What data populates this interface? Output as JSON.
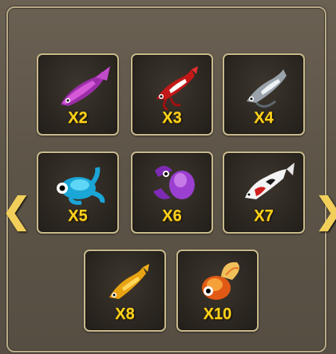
{
  "nav": {
    "prev_glyph": "❮",
    "next_glyph": "❯"
  },
  "cards": [
    {
      "creature": "purple-fish-icon",
      "multiplier": "X2"
    },
    {
      "creature": "red-shrimp-icon",
      "multiplier": "X3"
    },
    {
      "creature": "silver-shrimp-icon",
      "multiplier": "X4"
    },
    {
      "creature": "blue-frog-icon",
      "multiplier": "X5"
    },
    {
      "creature": "purple-crab-icon",
      "multiplier": "X6"
    },
    {
      "creature": "koi-fish-icon",
      "multiplier": "X7"
    },
    {
      "creature": "yellow-shrimp-icon",
      "multiplier": "X8"
    },
    {
      "creature": "goldfish-icon",
      "multiplier": "X10"
    }
  ]
}
